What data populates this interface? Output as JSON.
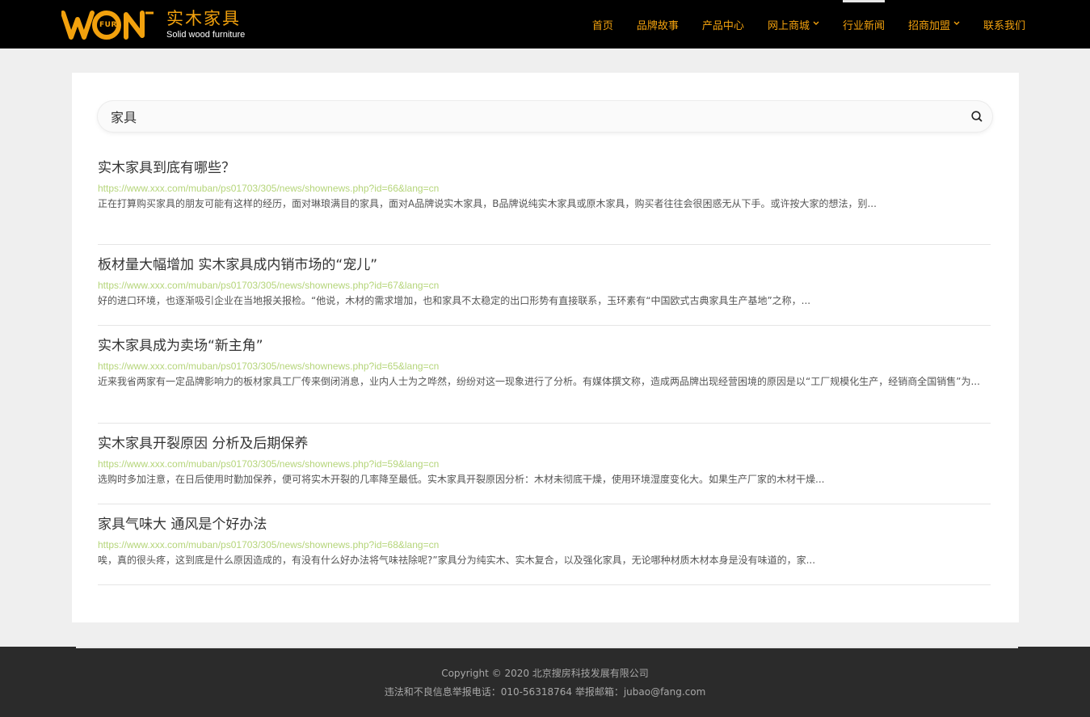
{
  "header": {
    "logo_wordmark": "WON",
    "logo_fur": "FUR",
    "logo_cn": "实木家具",
    "logo_en": "Solid wood furniture",
    "nav": [
      {
        "label": "首页"
      },
      {
        "label": "品牌故事"
      },
      {
        "label": "产品中心"
      },
      {
        "label": "网上商城",
        "dropdown": true
      },
      {
        "label": "行业新闻",
        "active": true
      },
      {
        "label": "招商加盟",
        "dropdown": true
      },
      {
        "label": "联系我们"
      }
    ]
  },
  "search": {
    "value": "家具"
  },
  "results": [
    {
      "title": "实木家具到底有哪些？",
      "url": "https://www.xxx.com/muban/ps01703/305/news/shownews.php?id=66&lang=cn",
      "desc": "正在打算购买家具的朋友可能有这样的经历，面对琳琅满目的家具，面对A品牌说实木家具，B品牌说纯实木家具或原木家具，购买者往往会很困惑无从下手。或许按大家的想法，别..."
    },
    {
      "title": "板材量大幅增加 实木家具成内销市场的“宠儿”",
      "url": "https://www.xxx.com/muban/ps01703/305/news/shownews.php?id=67&lang=cn",
      "desc": "好的进口环境，也逐渐吸引企业在当地报关报检。“他说，木材的需求增加，也和家具不太稳定的出口形势有直接联系，玉环素有“中国欧式古典家具生产基地”之称，..."
    },
    {
      "title": "实木家具成为卖场“新主角”",
      "url": "https://www.xxx.com/muban/ps01703/305/news/shownews.php?id=65&lang=cn",
      "desc": "近来我省两家有一定品牌影响力的板材家具工厂传来倒闭消息，业内人士为之哗然，纷纷对这一现象进行了分析。有媒体撰文称，造成两品牌出现经营困境的原因是以“工厂规模化生产，经销商全国销售”为..."
    },
    {
      "title": "实木家具开裂原因 分析及后期保养",
      "url": "https://www.xxx.com/muban/ps01703/305/news/shownews.php?id=59&lang=cn",
      "desc": "选购时多加注意，在日后使用时勤加保养，便可将实木开裂的几率降至最低。实木家具开裂原因分析：木材未彻底干燥，使用环境湿度变化大。如果生产厂家的木材干燥..."
    },
    {
      "title": "家具气味大 通风是个好办法",
      "url": "https://www.xxx.com/muban/ps01703/305/news/shownews.php?id=68&lang=cn",
      "desc": "唉，真的很头疼，这到底是什么原因造成的，有没有什么好办法将气味祛除呢?”家具分为纯实木、实木复合，以及强化家具，无论哪种材质木材本身是没有味道的，家..."
    }
  ],
  "footer": {
    "copyright": "Copyright © 2020 北京搜房科技发展有限公司",
    "report": "违法和不良信息举报电话：010-56318764 举报邮箱：jubao@fang.com"
  },
  "colors": {
    "accent": "#f2a10d",
    "header_bg": "#000000",
    "url_green": "#b5d57a",
    "footer_bg": "#2b2b2b"
  },
  "icons": {
    "search": "search-icon",
    "dropdown": "chevron-down-icon"
  }
}
